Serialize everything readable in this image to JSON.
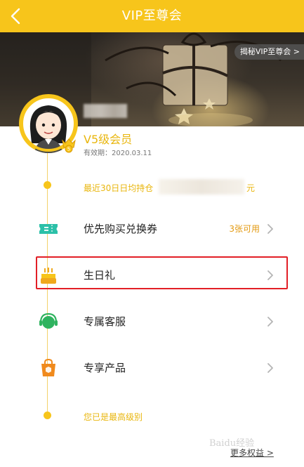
{
  "header": {
    "title": "VIP至尊会",
    "bg_color": "#f7c51b"
  },
  "banner": {
    "secret_button_label": "揭秘VIP至尊会 >"
  },
  "user": {
    "level": "V5级会员",
    "valid_until": "有效期：2020.03.11"
  },
  "notes": {
    "holding_prefix": "最近30日日均持仓",
    "holding_suffix": "元",
    "max_level": "您已是最高级别"
  },
  "benefits": [
    {
      "label": "优先购买兑换券",
      "extra": "3张可用",
      "icon": "ticket-icon"
    },
    {
      "label": "生日礼",
      "extra": "",
      "icon": "birthday-cake-icon"
    },
    {
      "label": "专属客服",
      "extra": "",
      "icon": "customer-service-headset-icon"
    },
    {
      "label": "专享产品",
      "extra": "",
      "icon": "shopping-bag-icon"
    }
  ],
  "footer": {
    "more_link": "更多权益 >",
    "watermark": "Baidu经验"
  },
  "colors": {
    "accent": "#f7c51b",
    "extra_text": "#e39a12",
    "highlight": "#e21f26"
  }
}
